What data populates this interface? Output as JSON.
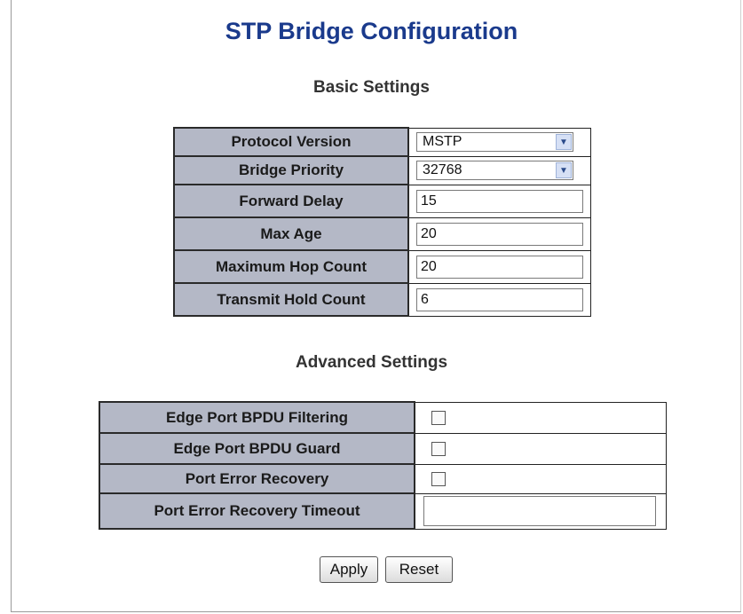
{
  "page": {
    "title": "STP Bridge Configuration"
  },
  "basic": {
    "title": "Basic Settings",
    "protocol_version": {
      "label": "Protocol Version",
      "value": "MSTP"
    },
    "bridge_priority": {
      "label": "Bridge Priority",
      "value": "32768"
    },
    "forward_delay": {
      "label": "Forward Delay",
      "value": "15"
    },
    "max_age": {
      "label": "Max Age",
      "value": "20"
    },
    "max_hop_count": {
      "label": "Maximum Hop Count",
      "value": "20"
    },
    "transmit_hold_count": {
      "label": "Transmit Hold Count",
      "value": "6"
    }
  },
  "advanced": {
    "title": "Advanced Settings",
    "edge_bpdu_filtering": {
      "label": "Edge Port BPDU Filtering",
      "checked": false
    },
    "edge_bpdu_guard": {
      "label": "Edge Port BPDU Guard",
      "checked": false
    },
    "port_error_recovery": {
      "label": "Port Error Recovery",
      "checked": false
    },
    "port_error_recovery_timeout": {
      "label": "Port Error Recovery Timeout",
      "value": ""
    }
  },
  "buttons": {
    "apply": "Apply",
    "reset": "Reset"
  },
  "icons": {
    "dropdown": "chevron-down-icon"
  }
}
